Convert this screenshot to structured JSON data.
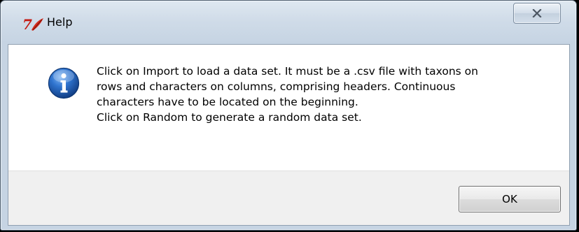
{
  "window": {
    "title": "Help",
    "close_label": "✕",
    "app_icon": "tk-feather-icon"
  },
  "dialog": {
    "icon": "info-icon",
    "message": "Click on Import to load a data set. It must be a .csv file with taxons on\nrows and characters on columns, comprising headers. Continuous\ncharacters have to be located on the beginning.\nClick on Random to generate a random data set.",
    "ok_label": "OK"
  },
  "colors": {
    "frame": "#c6d4e3",
    "info_blue": "#1f5fb5",
    "button_area": "#f0f0f0"
  }
}
